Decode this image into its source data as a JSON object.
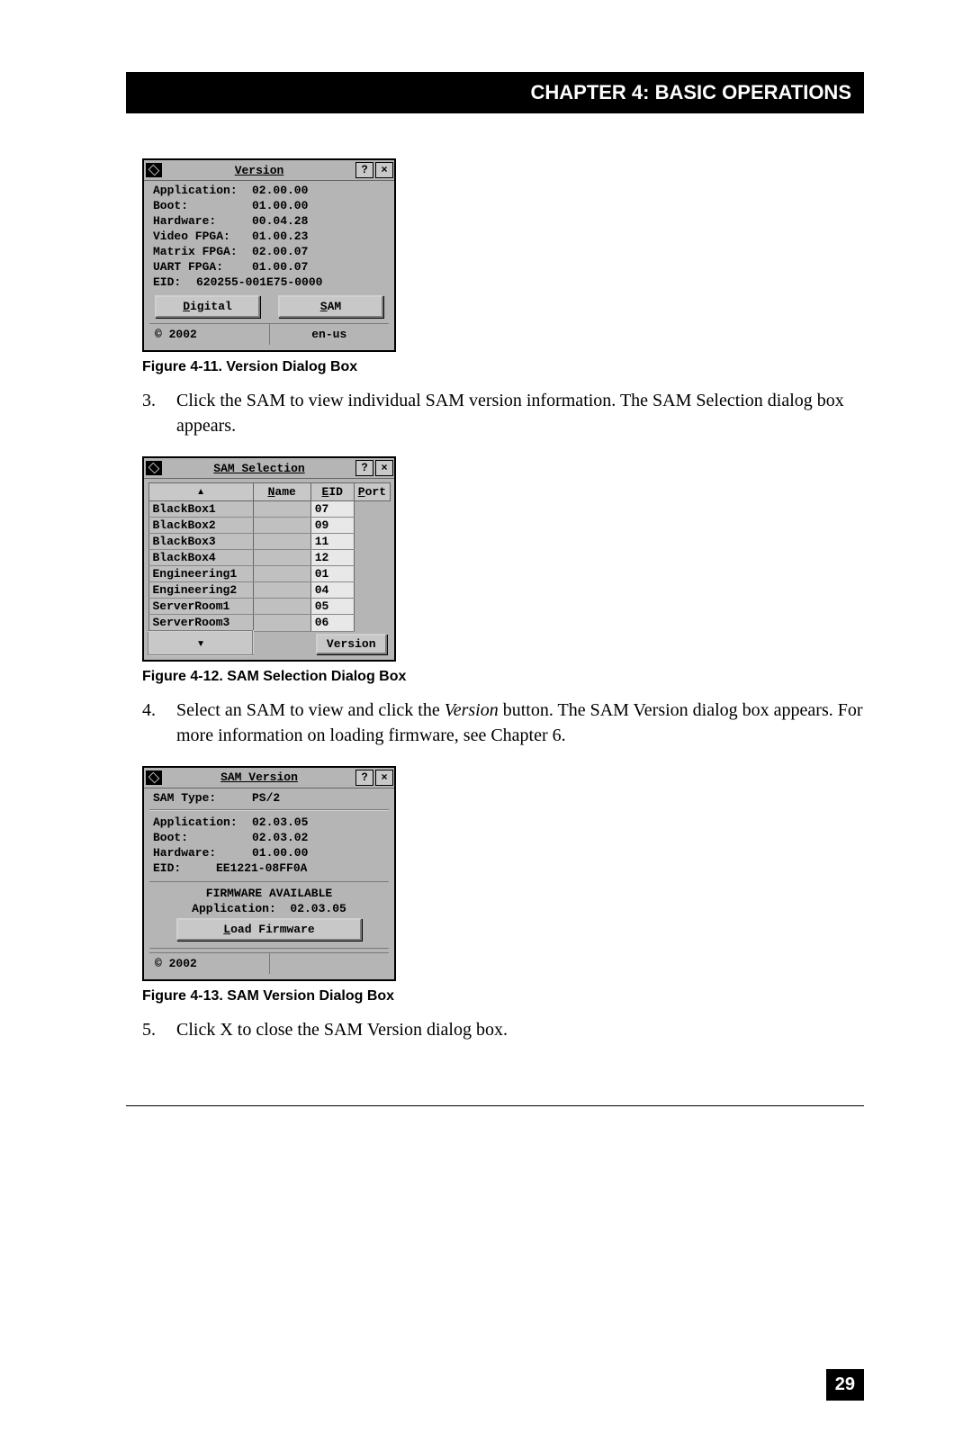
{
  "chapter_title": "CHAPTER 4: BASIC OPERATIONS",
  "page_number": "29",
  "version_dialog": {
    "title": "Version",
    "help_btn": "?",
    "close_btn": "×",
    "rows": [
      {
        "k": "Application:",
        "v": "02.00.00"
      },
      {
        "k": "Boot:",
        "v": "01.00.00"
      },
      {
        "k": "Hardware:",
        "v": "00.04.28"
      },
      {
        "k": "Video FPGA:",
        "v": "01.00.23"
      },
      {
        "k": "Matrix FPGA:",
        "v": "02.00.07"
      },
      {
        "k": "UART FPGA:",
        "v": "01.00.07"
      }
    ],
    "eid_label": "EID:",
    "eid_value": "620255-001E75-0000",
    "btn_digital": "Digital",
    "btn_digital_u": "D",
    "btn_sam": "SAM",
    "btn_sam_u": "S",
    "copyright": "© 2002",
    "locale": "en-us"
  },
  "fig11_caption": "Figure 4-11. Version Dialog Box",
  "step3_num": "3.",
  "step3_text": "Click the SAM to view individual SAM version information. The SAM Selection dialog box appears.",
  "sam_selection": {
    "title": "SAM Selection",
    "col_name": "Name",
    "col_name_u": "N",
    "col_eid": "EID",
    "col_eid_u": "E",
    "col_port": "Port",
    "col_port_u": "P",
    "scroll_up": "▲",
    "scroll_down": "▼",
    "rows": [
      {
        "name": "BlackBox1",
        "eid": "",
        "port": "07"
      },
      {
        "name": "BlackBox2",
        "eid": "",
        "port": "09"
      },
      {
        "name": "BlackBox3",
        "eid": "",
        "port": "11"
      },
      {
        "name": "BlackBox4",
        "eid": "",
        "port": "12"
      },
      {
        "name": "Engineering1",
        "eid": "",
        "port": "01"
      },
      {
        "name": "Engineering2",
        "eid": "",
        "port": "04"
      },
      {
        "name": "ServerRoom1",
        "eid": "",
        "port": "05"
      },
      {
        "name": "ServerRoom3",
        "eid": "",
        "port": "06"
      }
    ],
    "btn_version": "Version",
    "btn_version_u": "V"
  },
  "fig12_caption": "Figure 4-12. SAM Selection Dialog Box",
  "step4_num": "4.",
  "step4_text_a": "Select an SAM to view and click the ",
  "step4_text_em": "Version",
  "step4_text_b": " button.  The SAM Version dialog box appears. For more information on loading firmware, see Chapter 6.",
  "sam_version": {
    "title": "SAM Version",
    "type_label": "SAM Type:",
    "type_value": "PS/2",
    "rows": [
      {
        "k": "Application:",
        "v": "02.03.05"
      },
      {
        "k": "Boot:",
        "v": "02.03.02"
      },
      {
        "k": "Hardware:",
        "v": "01.00.00"
      }
    ],
    "eid_label": "EID:",
    "eid_value": "EE1221-08FF0A",
    "fw_header": "FIRMWARE AVAILABLE",
    "fw_app_label": "Application:",
    "fw_app_value": "02.03.05",
    "btn_load": "Load Firmware",
    "btn_load_u": "L",
    "copyright": "© 2002"
  },
  "fig13_caption": "Figure 4-13. SAM Version Dialog Box",
  "step5_num": "5.",
  "step5_text": "Click X to close the SAM Version dialog box."
}
